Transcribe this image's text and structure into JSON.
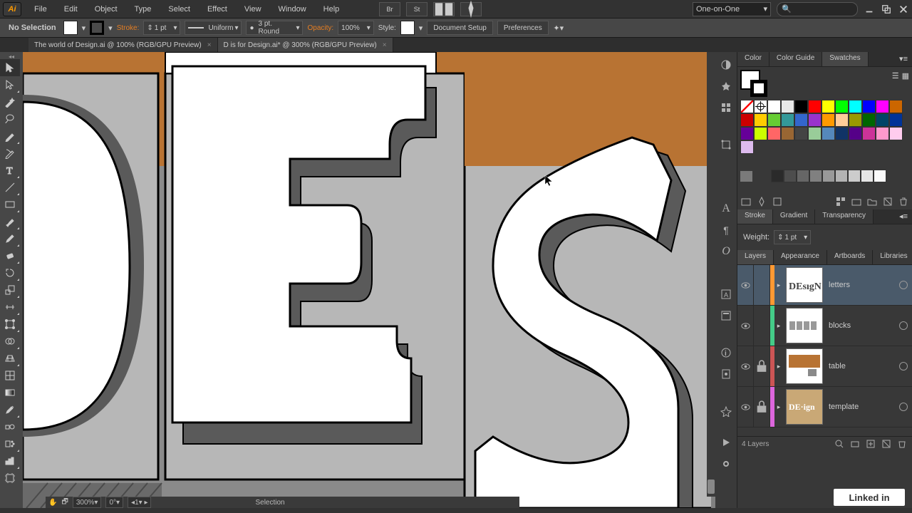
{
  "menubar": {
    "items": [
      "File",
      "Edit",
      "Object",
      "Type",
      "Select",
      "Effect",
      "View",
      "Window",
      "Help"
    ],
    "workspace": "One-on-One",
    "search_placeholder": "🔍"
  },
  "controlbar": {
    "selection": "No Selection",
    "stroke_label": "Stroke:",
    "stroke_weight": "1 pt",
    "stroke_variable": "Uniform",
    "stroke_profile": "3 pt. Round",
    "opacity_label": "Opacity:",
    "opacity": "100%",
    "style_label": "Style:",
    "doc_setup": "Document Setup",
    "preferences": "Preferences"
  },
  "tabs": [
    {
      "label": "The world of Design.ai @ 100% (RGB/GPU Preview)",
      "active": false
    },
    {
      "label": "D is for Design.ai* @ 300% (RGB/GPU Preview)",
      "active": true
    }
  ],
  "panel_color_tabs": [
    "Color",
    "Color Guide",
    "Swatches"
  ],
  "panel_stroke_tabs": [
    "Stroke",
    "Gradient",
    "Transparency"
  ],
  "panel_layers_tabs": [
    "Layers",
    "Appearance",
    "Artboards",
    "Libraries"
  ],
  "stroke_panel": {
    "weight_label": "Weight:",
    "weight": "1 pt"
  },
  "layers": [
    {
      "name": "letters",
      "bar": "#ff9933",
      "thumb": "letters"
    },
    {
      "name": "blocks",
      "bar": "#44cc88",
      "thumb": "blocks"
    },
    {
      "name": "table",
      "bar": "#cc5555",
      "thumb": "table",
      "locked": true
    },
    {
      "name": "template",
      "bar": "#dd66dd",
      "thumb": "template",
      "locked": true
    }
  ],
  "layers_footer": "4 Layers",
  "swatches_colors": [
    "#ffffff",
    "#e8e8e8",
    "#000000",
    "#ff0000",
    "#ffff00",
    "#00ff00",
    "#00ffff",
    "#0000ff",
    "#ff00ff",
    "#cc6600",
    "#cc0000",
    "#ffcc00",
    "#66cc33",
    "#339999",
    "#3366cc",
    "#9933cc",
    "#ff9900",
    "#ffcc99",
    "#999900",
    "#006600",
    "#004466",
    "#003399",
    "#660099",
    "#ccff00",
    "#ff6666",
    "#996633",
    "#444444",
    "#99cc99",
    "#5588bb",
    "#113366",
    "#550088",
    "#cc3399",
    "#ff99cc",
    "#ffccee",
    "#ddbbee"
  ],
  "grays": [
    "#2a2a2a",
    "#4d4d4d",
    "#666666",
    "#808080",
    "#999999",
    "#b3b3b3",
    "#cccccc",
    "#e6e6e6",
    "#fafafa"
  ],
  "statusbar": {
    "zoom": "300%",
    "rotation": "0°",
    "page": "1",
    "tool": "Selection"
  },
  "linked": "Linked in"
}
